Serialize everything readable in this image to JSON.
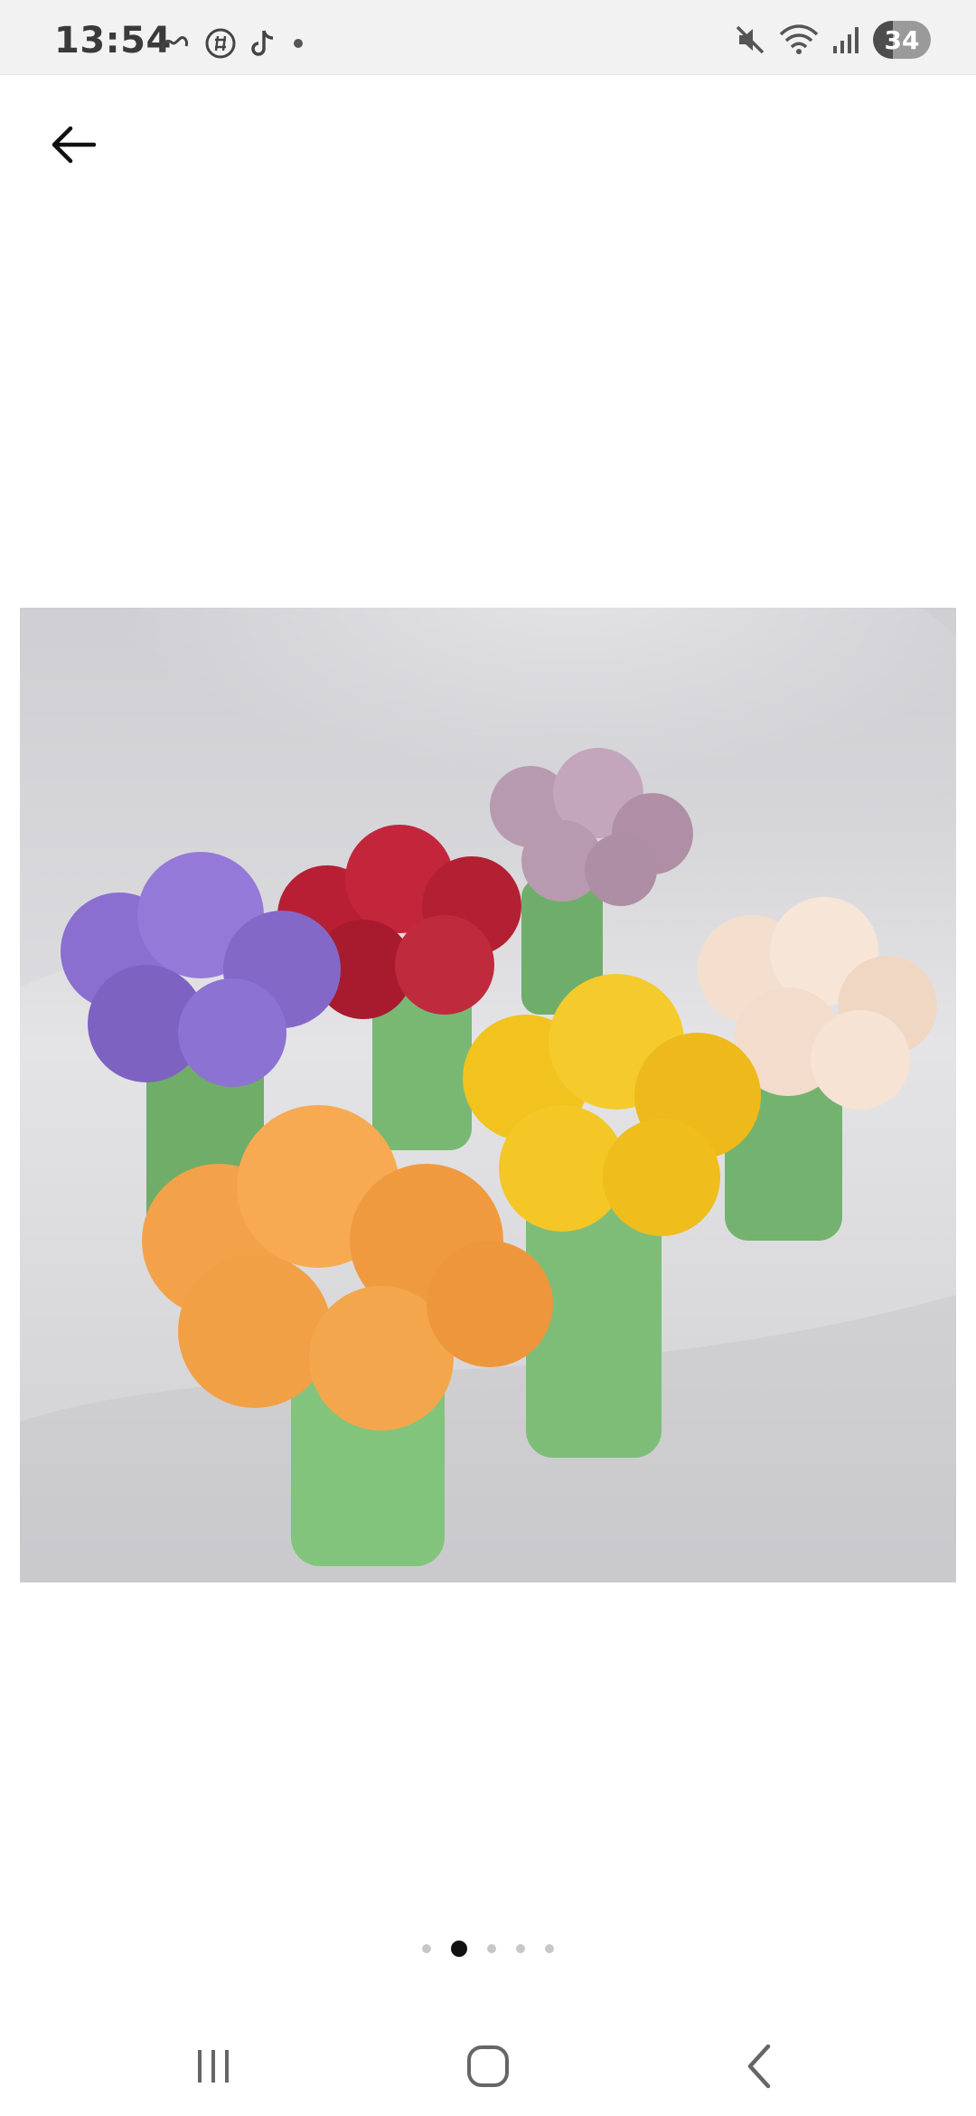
{
  "status_bar": {
    "time": "13:54",
    "battery": "34",
    "battery_level_percent": 34,
    "left_icons": [
      "link-icon",
      "app-icon",
      "tiktok-icon",
      "notification-dot-icon"
    ],
    "right_icons": [
      "mute-icon",
      "wifi-icon",
      "signal-icon",
      "battery-icon"
    ]
  },
  "toolbar": {
    "back_icon": "back-arrow-icon"
  },
  "gallery": {
    "image_icon": "product-photo",
    "pages": 5,
    "active_page": 2
  },
  "colors": {
    "purple": "#8a6fd0",
    "red": "#c3263b",
    "mauve": "#b89ab0",
    "cream": "#f4dfcf",
    "yellow": "#f2c21f",
    "orange": "#f3a24a",
    "stem": "#7fbf7a"
  },
  "navbar": {
    "recents": "recents-icon",
    "home": "home-icon",
    "back": "back-icon"
  }
}
